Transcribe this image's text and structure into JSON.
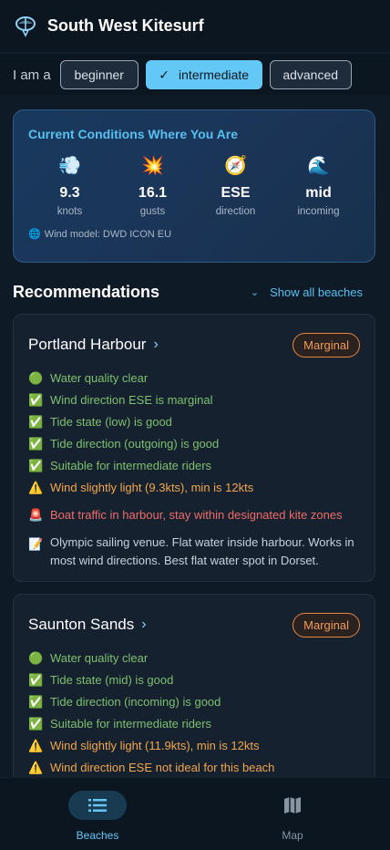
{
  "app": {
    "title": "South West Kitesurf",
    "logo_icon": "kite-icon"
  },
  "skill": {
    "label": "I am a",
    "options": [
      {
        "label": "beginner",
        "selected": false
      },
      {
        "label": "intermediate",
        "selected": true
      },
      {
        "label": "advanced",
        "selected": false
      }
    ]
  },
  "conditions": {
    "title": "Current Conditions Where You Are",
    "metrics": [
      {
        "icon": "wind-icon",
        "glyph": "💨",
        "value": "9.3",
        "unit": "knots"
      },
      {
        "icon": "gust-icon",
        "glyph": "💥",
        "value": "16.1",
        "unit": "gusts"
      },
      {
        "icon": "compass-icon",
        "glyph": "🧭",
        "value": "ESE",
        "unit": "direction"
      },
      {
        "icon": "wave-icon",
        "glyph": "🌊",
        "value": "mid",
        "unit": "incoming"
      }
    ],
    "model": "Wind model: DWD ICON EU"
  },
  "recommendations": {
    "heading": "Recommendations",
    "show_all": "Show all beaches",
    "beaches": [
      {
        "name": "Portland Harbour",
        "rating": "Marginal",
        "items": [
          {
            "tone": "green",
            "icon": "🟢",
            "text": "Water quality clear"
          },
          {
            "tone": "green",
            "icon": "✅",
            "text": "Wind direction ESE is marginal"
          },
          {
            "tone": "green",
            "icon": "✅",
            "text": "Tide state (low) is good"
          },
          {
            "tone": "green",
            "icon": "✅",
            "text": "Tide direction (outgoing) is good"
          },
          {
            "tone": "green",
            "icon": "✅",
            "text": "Suitable for intermediate riders"
          },
          {
            "tone": "orange",
            "icon": "⚠️",
            "text": "Wind slightly light (9.3kts), min is 12kts"
          },
          {
            "tone": "red",
            "icon": "🚨",
            "text": "Boat traffic in harbour, stay within designated kite zones"
          },
          {
            "tone": "note",
            "icon": "📝",
            "text": "Olympic sailing venue. Flat water inside harbour. Works in most wind directions. Best flat water spot in Dorset."
          }
        ]
      },
      {
        "name": "Saunton Sands",
        "rating": "Marginal",
        "items": [
          {
            "tone": "green",
            "icon": "🟢",
            "text": "Water quality clear"
          },
          {
            "tone": "green",
            "icon": "✅",
            "text": "Tide state (mid) is good"
          },
          {
            "tone": "green",
            "icon": "✅",
            "text": "Tide direction (incoming) is good"
          },
          {
            "tone": "green",
            "icon": "✅",
            "text": "Suitable for intermediate riders"
          },
          {
            "tone": "orange",
            "icon": "⚠️",
            "text": "Wind slightly light (11.9kts), min is 12kts"
          },
          {
            "tone": "orange",
            "icon": "⚠️",
            "text": "Wind direction ESE not ideal for this beach"
          }
        ]
      }
    ]
  },
  "nav": {
    "items": [
      {
        "label": "Beaches",
        "icon": "list-icon",
        "active": true
      },
      {
        "label": "Map",
        "icon": "map-icon",
        "active": false
      }
    ]
  },
  "colors": {
    "accent": "#63c8f5",
    "marginal": "#e8863a",
    "background": "#0f1a27"
  }
}
